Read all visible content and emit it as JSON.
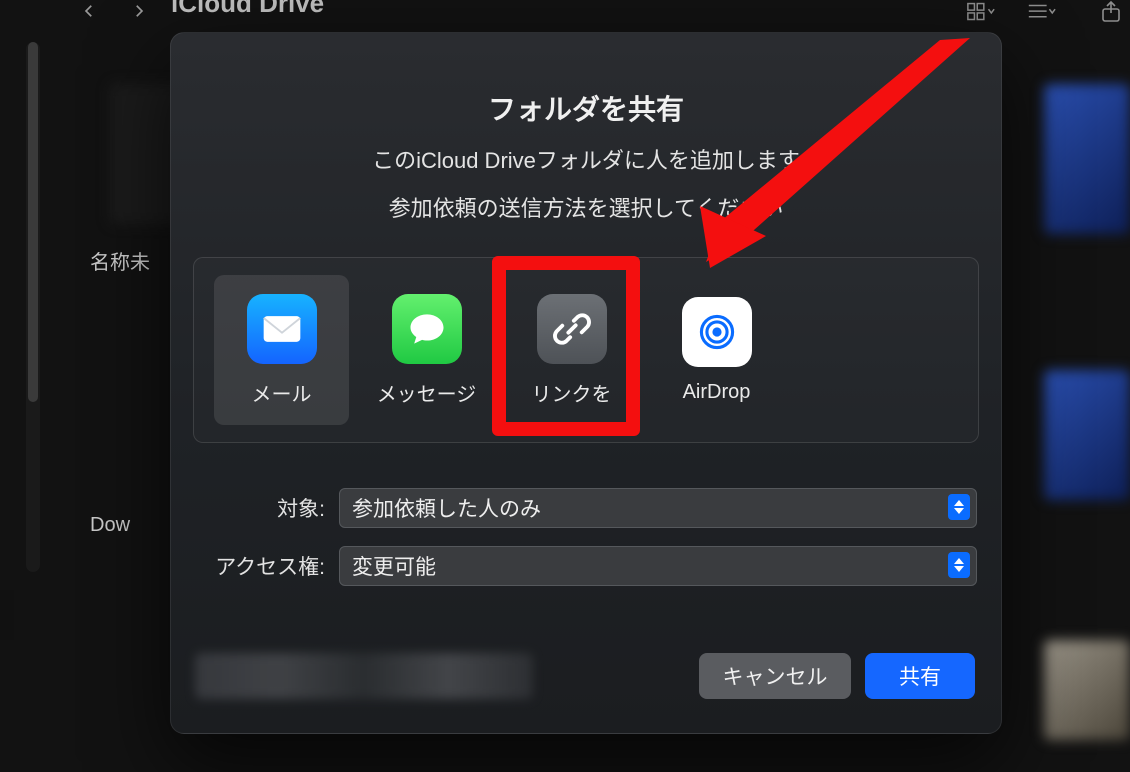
{
  "header": {
    "location_title": "iCloud Drive"
  },
  "sidebar": {
    "folder_label_1": "名称未",
    "folder_label_2": "Dow"
  },
  "dialog": {
    "title": "フォルダを共有",
    "subtitle1": "このiCloud Driveフォルダに人を追加します",
    "subtitle2": "参加依頼の送信方法を選択してください",
    "options": {
      "mail": {
        "label": "メール"
      },
      "message": {
        "label": "メッセージ"
      },
      "link": {
        "label": "リンクを"
      },
      "airdrop": {
        "label": "AirDrop"
      }
    },
    "audience": {
      "label": "対象:",
      "value": "参加依頼した人のみ"
    },
    "permission": {
      "label": "アクセス権:",
      "value": "変更可能"
    },
    "buttons": {
      "cancel": "キャンセル",
      "share": "共有"
    }
  }
}
